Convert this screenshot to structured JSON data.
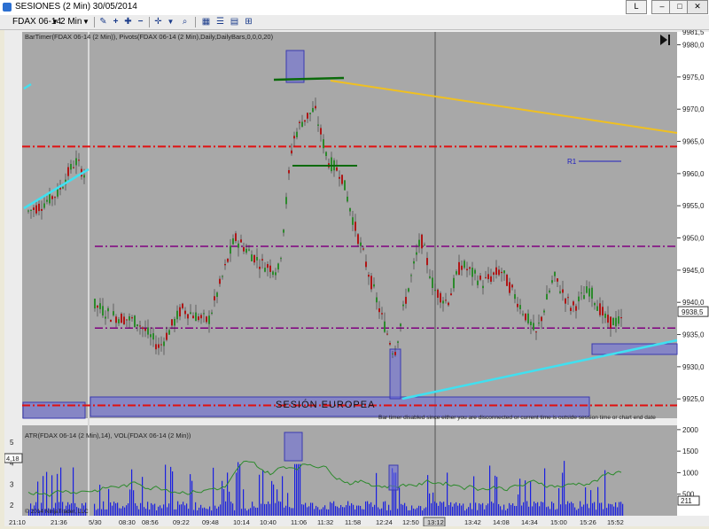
{
  "window": {
    "title": "SESIONES (2 Min)  30/05/2014",
    "restore_label": "L",
    "min_label": "–",
    "max_label": "□",
    "close_label": "✕"
  },
  "toolbar": {
    "instrument": "FDAX 06-14",
    "interval": "2 Min",
    "icons": [
      "chevron-down-icon",
      "pencil-icon",
      "zoom-in-icon",
      "zoom-out-icon",
      "crosshair-icon",
      "magnifier-icon",
      "data-box-icon",
      "properties-icon",
      "chart-trader-icon",
      "pin-icon"
    ]
  },
  "chart_data": {
    "type": "candlestick",
    "header_text": "BarTimer(FDAX 06-14 (2 Min)), Pivots(FDAX 06-14 (2 Min),Daily,DailyBars,0,0,0,20)",
    "price_ticks": [
      "9980,0",
      "9975,0",
      "9970,0",
      "9965,0",
      "9960,0",
      "9955,0",
      "9950,0",
      "9945,0",
      "9940,0",
      "9935,0",
      "9930,0",
      "9925,0"
    ],
    "price_range": [
      9922.0,
      9982.0
    ],
    "top_right_price": "9981,5",
    "last_price": "9938,5",
    "time_ticks": [
      "21:10",
      "21:36",
      "5/30",
      "08:30",
      "08:56",
      "09:22",
      "09:48",
      "10:14",
      "10:40",
      "11:06",
      "11:32",
      "11:58",
      "12:24",
      "12:50",
      "13:12",
      "13:42",
      "14:08",
      "14:34",
      "15:00",
      "15:26",
      "15:52"
    ],
    "cursor_time": "13:12",
    "horizontal_lines": [
      {
        "price": 9964.2,
        "color": "#e01010",
        "style": "dashdot"
      },
      {
        "price": 9948.7,
        "color": "#800080",
        "style": "dashdot"
      },
      {
        "price": 9936.0,
        "color": "#800080",
        "style": "dashdot"
      },
      {
        "price": 9924.0,
        "color": "#e01010",
        "style": "dashdot"
      }
    ],
    "pivot_label": "R1",
    "session_label": "SESIÓN EUROPEA",
    "bartimer_message": "Bar timer disabled since either you are disconnected or current time is outside session time or chart end date",
    "indicator_header": "ATR(FDAX 06-14 (2 Min),14), VOL(FDAX 06-14 (2 Min))",
    "atr_ticks": [
      "5",
      "4",
      "3",
      "2"
    ],
    "atr_current": "4,18",
    "vol_ticks": [
      "2000",
      "1500",
      "1000",
      "500"
    ],
    "vol_current": "211",
    "copyright": "© 2014 NinjaTrader, LLC",
    "colors": {
      "background": "#a8a8a8",
      "up_candle": "#2c8a2c",
      "down_candle": "#b01616",
      "atr_line": "#2c8a2c",
      "volume": "#1a20e0",
      "cyan_trend": "#40e0f0",
      "yellow_trend": "#f0c020",
      "green_level": "#0a6a0a",
      "box_fill": "#6a6adc"
    }
  }
}
